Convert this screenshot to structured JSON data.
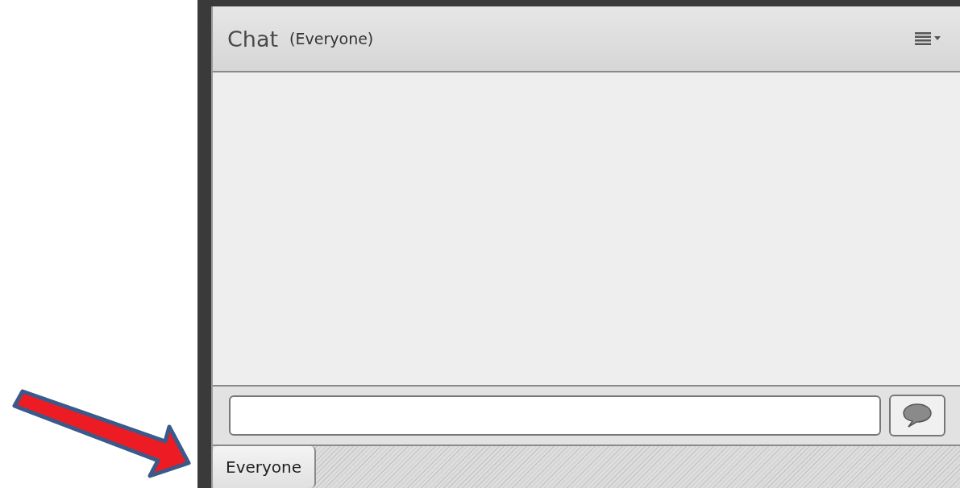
{
  "chat_panel": {
    "title": "Chat",
    "scope": "(Everyone)"
  },
  "tabs": [
    {
      "label": "Everyone",
      "selected": true
    }
  ]
}
